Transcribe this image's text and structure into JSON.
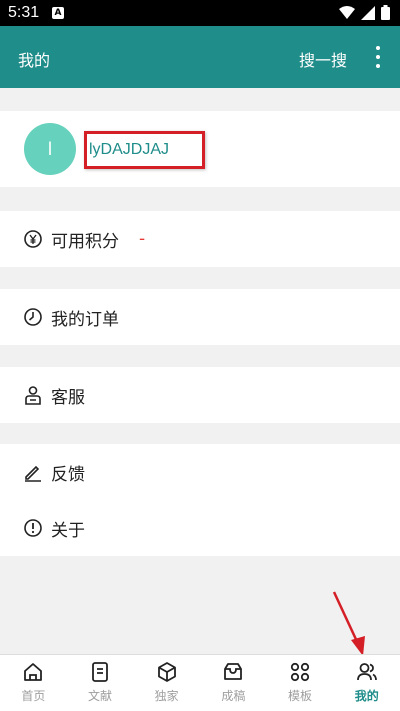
{
  "status": {
    "time": "5:31",
    "notif_glyph": "A"
  },
  "header": {
    "title": "我的",
    "search_label": "搜一搜"
  },
  "profile": {
    "avatar_letter": "l",
    "username": "lyDAJDJAJ"
  },
  "points": {
    "label": "可用积分",
    "value": "-"
  },
  "orders": {
    "label": "我的订单"
  },
  "service": {
    "label": "客服"
  },
  "feedback": {
    "label": "反馈"
  },
  "about": {
    "label": "关于"
  },
  "nav": {
    "items": [
      {
        "label": "首页",
        "icon": "home-icon"
      },
      {
        "label": "文献",
        "icon": "document-icon"
      },
      {
        "label": "独家",
        "icon": "cube-icon"
      },
      {
        "label": "成稿",
        "icon": "inbox-icon"
      },
      {
        "label": "模板",
        "icon": "grid-icon"
      },
      {
        "label": "我的",
        "icon": "people-icon"
      }
    ]
  },
  "colors": {
    "accent": "#1f8d8a",
    "avatar": "#66d1bc",
    "highlight": "#d41f26"
  }
}
